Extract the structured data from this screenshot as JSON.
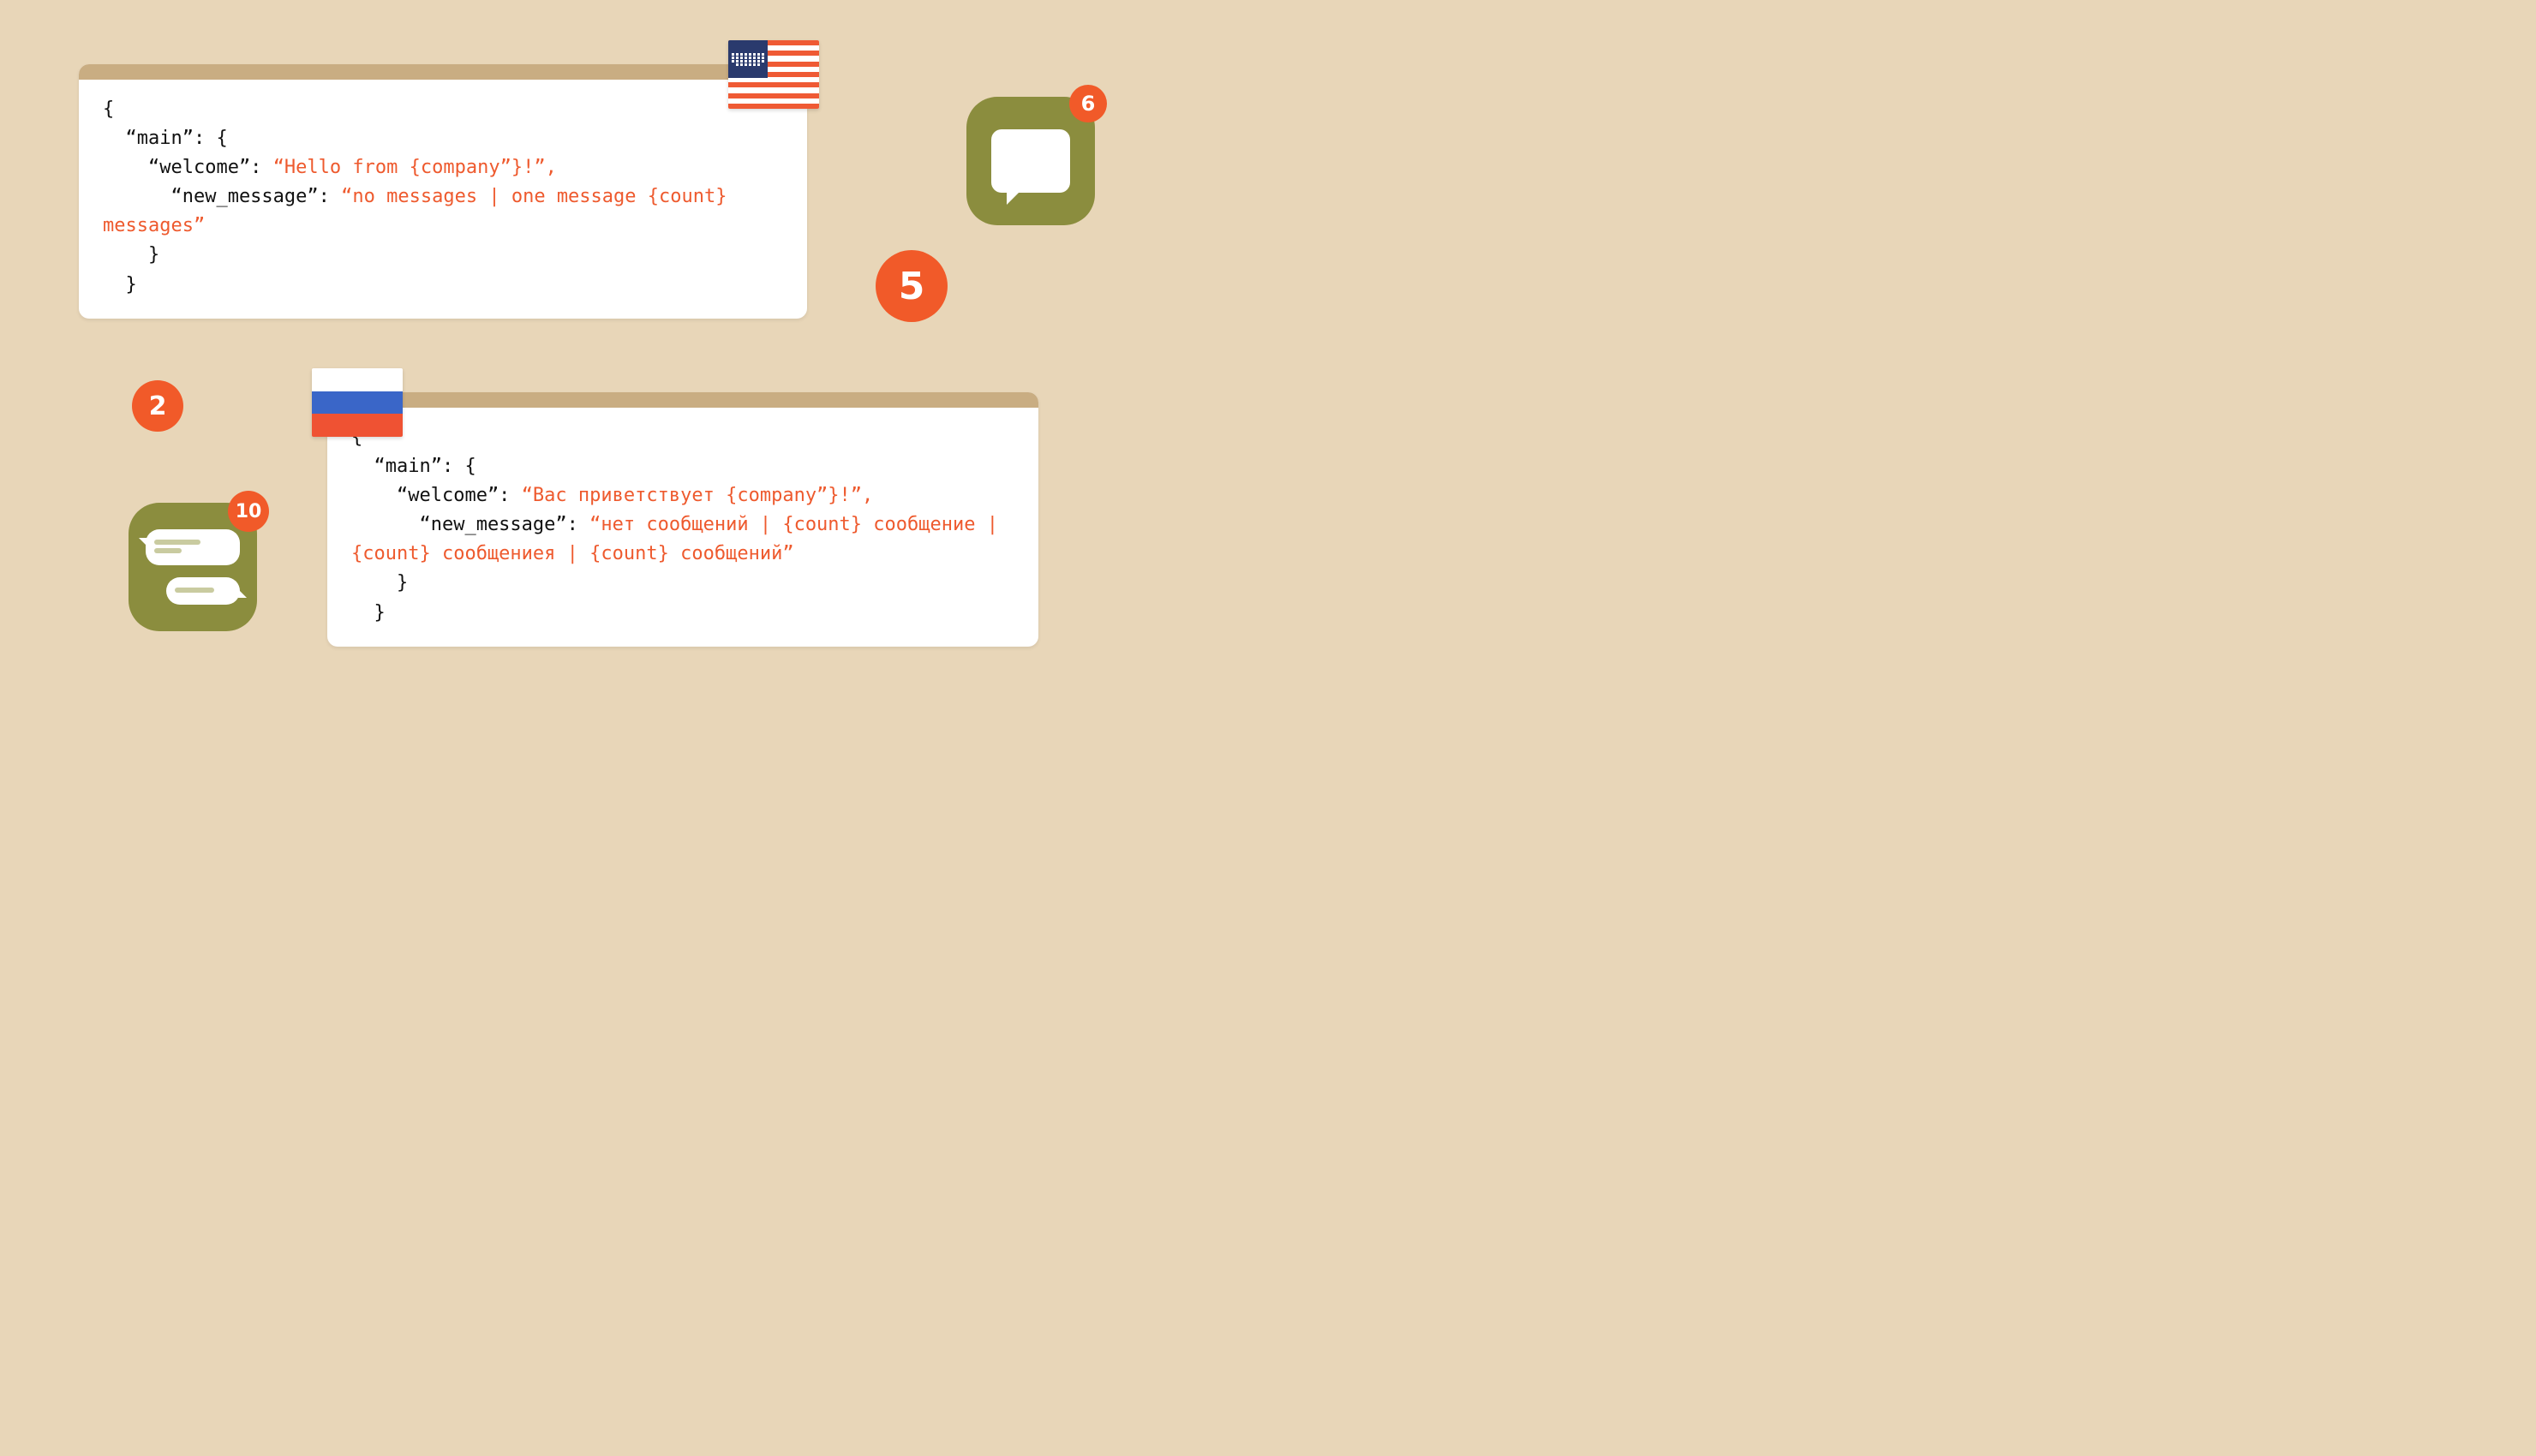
{
  "panels": {
    "en": {
      "flag": "us",
      "line1": "{",
      "line2": "  “main”: {",
      "line3a": "    “welcome”: ",
      "line3b": "“Hello from {company”}!”,",
      "line4a": "      “new_message”: ",
      "line4b": "“no messages | one message {count}",
      "line5": "messages”",
      "line6": "    }",
      "line7": "  }"
    },
    "ru": {
      "flag": "ru",
      "line1": "{",
      "line2": "  “main”: {",
      "line3a": "    “welcome”: ",
      "line3b": "“Вас приветствует {company”}!”,",
      "line4a": "      “new_message”: ",
      "line4b": "“нет сообщений | {count} сообщение |",
      "line5": "{count} сообщениея | {count} сообщений”",
      "line6": "    }",
      "line7": "  }"
    }
  },
  "circles": {
    "five": "5",
    "two": "2"
  },
  "icons": {
    "chat_badge": "6",
    "msgs_badge": "10"
  }
}
